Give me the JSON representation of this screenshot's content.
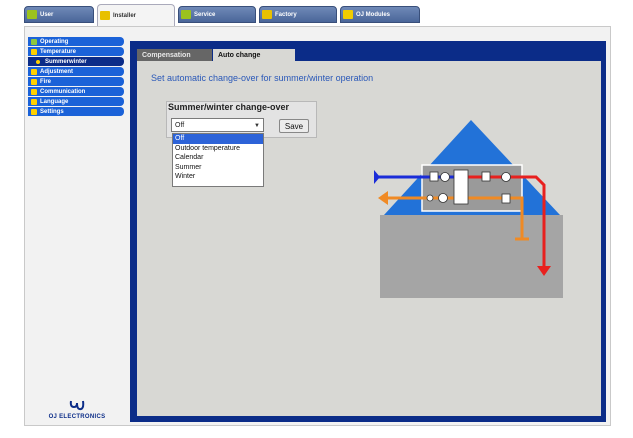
{
  "top_tabs": [
    {
      "label": "User"
    },
    {
      "label": "Installer"
    },
    {
      "label": "Service"
    },
    {
      "label": "Factory"
    },
    {
      "label": "OJ Modules"
    }
  ],
  "sidebar": {
    "items": [
      {
        "label": "Operating"
      },
      {
        "label": "Temperature"
      },
      {
        "label": "Summerwinter"
      },
      {
        "label": "Adjustment"
      },
      {
        "label": "Fire"
      },
      {
        "label": "Communication"
      },
      {
        "label": "Language"
      },
      {
        "label": "Settings"
      }
    ]
  },
  "logo": {
    "mark": "OJ",
    "text": "OJ ELECTRONICS"
  },
  "sub_tabs": [
    {
      "label": "Compensation"
    },
    {
      "label": "Auto change"
    }
  ],
  "heading": "Set automatic change-over for summer/winter operation",
  "changeover": {
    "title": "Summer/winter change-over",
    "selected": "Off",
    "save_label": "Save",
    "options": [
      "Off",
      "Outdoor temperature",
      "Calendar",
      "Summer",
      "Winter"
    ]
  },
  "colors": {
    "accent_blue": "#0b2c88",
    "sidebar_blue": "#1b62d8",
    "heading_blue": "#2a58b8",
    "supply_air": "#e8201e",
    "extract_air": "#f08a24",
    "outdoor_air": "#1a2cd8"
  }
}
